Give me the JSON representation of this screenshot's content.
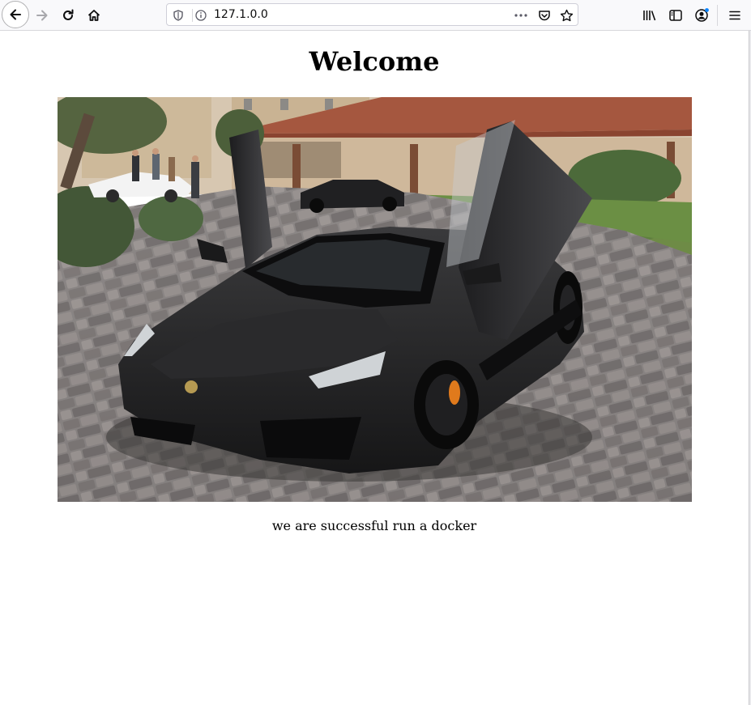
{
  "browser": {
    "url": "127.1.0.0",
    "icons": {
      "back": "back-arrow-icon",
      "forward": "forward-arrow-icon",
      "reload": "reload-icon",
      "home": "home-icon",
      "shield": "tracking-shield-icon",
      "info": "site-info-icon",
      "more": "page-actions-more-icon",
      "pocket": "pocket-icon",
      "bookmark": "bookmark-star-icon",
      "library": "library-icon",
      "sidebar": "sidebar-icon",
      "account": "account-icon",
      "menu": "hamburger-menu-icon"
    },
    "accent_color": "#0a84ff"
  },
  "page": {
    "heading": "Welcome",
    "image_subject": "black sports car with scissor doors open on cobblestone courtyard",
    "caption": "we are successful run a docker"
  }
}
